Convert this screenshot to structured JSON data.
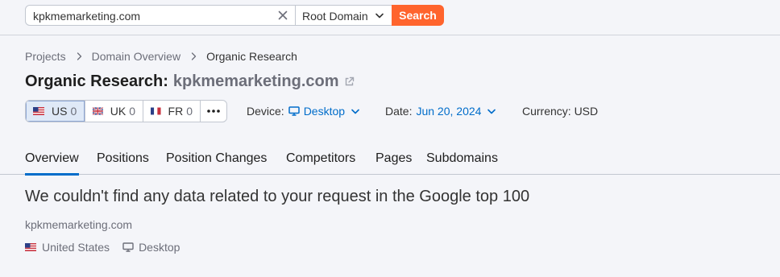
{
  "search": {
    "query": "kpkmemarketing.com",
    "scope": "Root Domain",
    "button_label": "Search"
  },
  "breadcrumb": [
    "Projects",
    "Domain Overview",
    "Organic Research"
  ],
  "title": {
    "prefix": "Organic Research:",
    "domain": "kpkmemarketing.com"
  },
  "databases": [
    {
      "code": "US",
      "count": "0",
      "flag": "us-flag",
      "active": true
    },
    {
      "code": "UK",
      "count": "0",
      "flag": "uk-flag",
      "active": false
    },
    {
      "code": "FR",
      "count": "0",
      "flag": "fr-flag",
      "active": false
    }
  ],
  "more_label": "•••",
  "filters": {
    "device_label": "Device:",
    "device_value": "Desktop",
    "date_label": "Date:",
    "date_value": "Jun 20, 2024",
    "currency_label": "Currency: USD"
  },
  "tabs": [
    "Overview",
    "Positions",
    "Position Changes",
    "Competitors",
    "Pages",
    "Subdomains"
  ],
  "active_tab": "Overview",
  "empty_state": {
    "message": "We couldn't find any data related to your request in the Google top 100",
    "domain": "kpkmemarketing.com",
    "country": "United States",
    "device": "Desktop"
  },
  "colors": {
    "accent": "#006dca",
    "search_button": "#ff642d",
    "background": "#f4f5f9"
  }
}
